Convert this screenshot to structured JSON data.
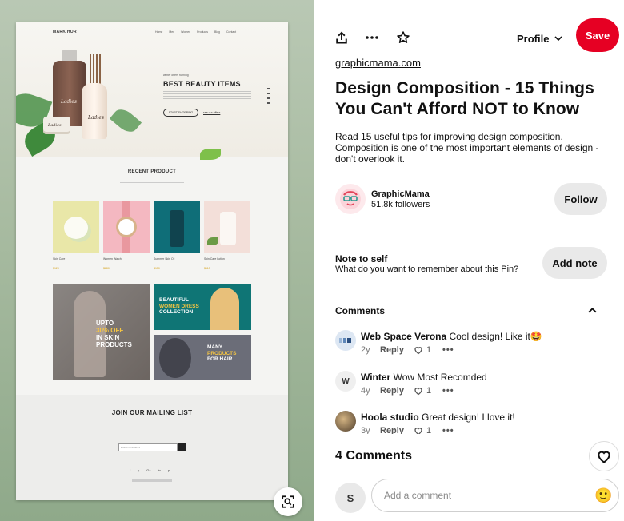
{
  "mockup": {
    "logo": "MARK HOR",
    "nav": [
      "Home",
      "Men",
      "Women",
      "Products",
      "Blog",
      "Contact"
    ],
    "hero_kicker": "winter offers running",
    "hero_title": "BEST BEAUTY ITEMS",
    "hero_button": "START SHOPPING",
    "hero_link": "see our offers",
    "brand_label": "Ladies",
    "recent_title": "RECENT PRODUCT",
    "products": [
      {
        "name": "Skin Care",
        "price": "$120"
      },
      {
        "name": "Women Watch",
        "price": "$280"
      },
      {
        "name": "Summer Skin Oil",
        "price": "$150"
      },
      {
        "name": "Skin Care Lotion",
        "price": "$110"
      }
    ],
    "tile_sale": {
      "line1": "UPTO",
      "line2": "30% OFF",
      "line3": "IN SKIN",
      "line4": "PRODUCTS"
    },
    "tile_women": {
      "line1": "BEAUTIFUL",
      "line2": "WOMEN DRESS",
      "line3": "COLLECTION"
    },
    "tile_hair": {
      "line1": "MANY",
      "line2": "PRODUCTS",
      "line3": "FOR HAIR"
    },
    "mailing_title": "JOIN OUR MAILING LIST",
    "mailing_placeholder": "EMAIL ADDRESS",
    "social": [
      "f",
      "y",
      "G+",
      "in",
      "p"
    ]
  },
  "toolbar": {
    "share_icon": "share-icon",
    "more_icon": "more-icon",
    "star_icon": "star-icon",
    "profile_label": "Profile",
    "save_label": "Save"
  },
  "pin": {
    "source": "graphicmama.com",
    "title": "Design Composition - 15 Things You Can't Afford NOT to Know",
    "description": "Read 15 useful tips for improving design composition. Composition is one of the most important elements of design - don't overlook it."
  },
  "author": {
    "name": "GraphicMama",
    "followers": "51.8k followers",
    "follow_label": "Follow"
  },
  "note": {
    "title": "Note to self",
    "subtitle": "What do you want to remember about this Pin?",
    "button": "Add note"
  },
  "comments": {
    "heading": "Comments",
    "reply_label": "Reply",
    "items": [
      {
        "author": "Web Space Verona",
        "text": "Cool design! Like it🤩",
        "time": "2y",
        "likes": "1",
        "avatar": ""
      },
      {
        "author": "Winter",
        "text": "Wow Most Recomded",
        "time": "4y",
        "likes": "1",
        "avatar": "W"
      },
      {
        "author": "Hoola studio",
        "text": "Great design! I love it!",
        "time": "3y",
        "likes": "1",
        "avatar": ""
      }
    ],
    "count_label": "4 Comments",
    "input_placeholder": "Add a comment",
    "user_initial": "S",
    "emoji": "🙂"
  },
  "colors": {
    "brand_red": "#e60023",
    "gray_button": "#e9e9e9"
  }
}
